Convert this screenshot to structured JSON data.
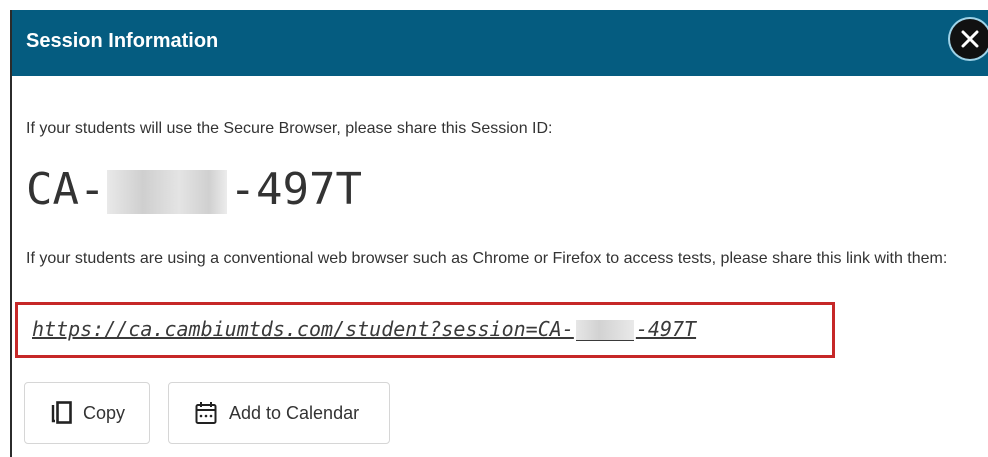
{
  "dialog": {
    "title": "Session Information",
    "close_label": "close"
  },
  "intro_text": "If your students will use the Secure Browser, please share this Session ID:",
  "session_id": {
    "prefix": "CA-",
    "suffix": "-497T"
  },
  "link_intro_text": "If your students are using a conventional web browser such as Chrome or Firefox to access tests, please share this link with them:",
  "session_link": {
    "prefix": "https://ca.cambiumtds.com/student?session=CA-",
    "suffix": "-497T"
  },
  "buttons": {
    "copy_label": "Copy",
    "copy_icon": "copy-icon",
    "calendar_label": "Add to Calendar",
    "calendar_icon": "calendar-icon"
  },
  "colors": {
    "header": "#055c80",
    "highlight_border": "#c62828",
    "text": "#333333"
  }
}
